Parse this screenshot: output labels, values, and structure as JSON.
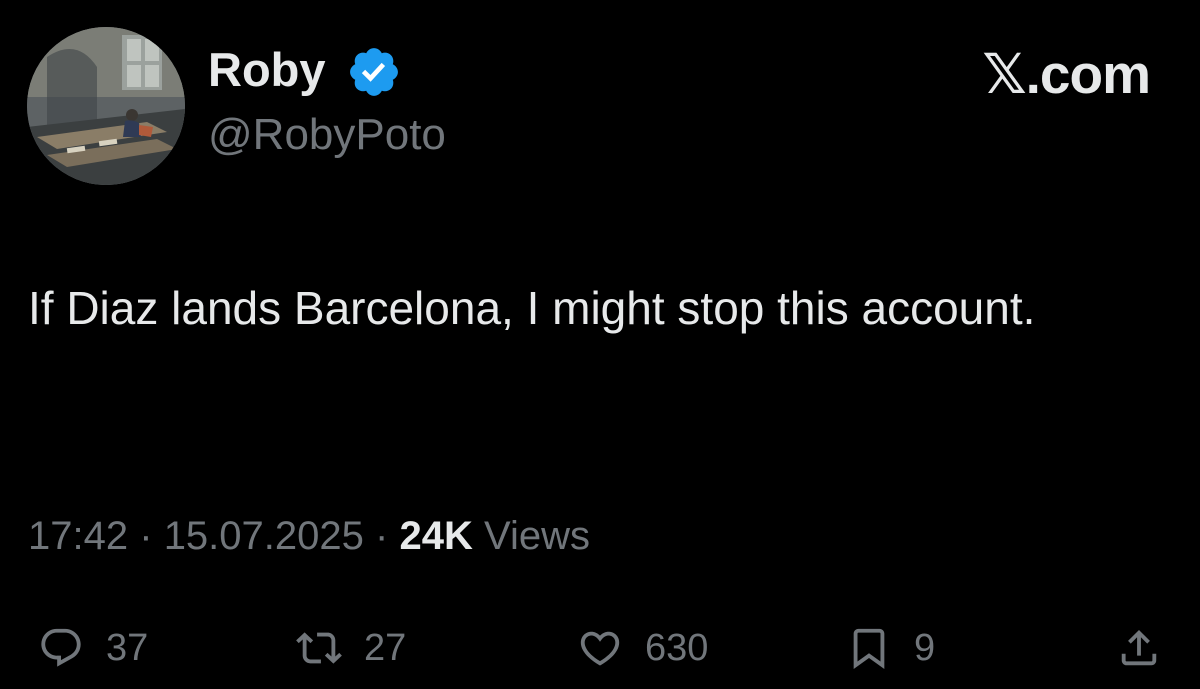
{
  "user": {
    "display_name": "Roby",
    "handle": "@RobyPoto",
    "verified": true
  },
  "brand": "𝕏.com",
  "tweet": {
    "text": "If Diaz lands Barcelona, I might stop this account.",
    "time": "17:42",
    "date": "15.07.2025",
    "separator": "·",
    "views_count": "24K",
    "views_label": "Views"
  },
  "actions": {
    "reply_count": "37",
    "repost_count": "27",
    "like_count": "630",
    "bookmark_count": "9"
  },
  "colors": {
    "background": "#000000",
    "primary_text": "#e7e9ea",
    "secondary_text": "#71767b",
    "verified_blue": "#1d9bf0"
  },
  "icons": {
    "verified": "verified-badge-icon",
    "reply": "reply-icon",
    "repost": "repost-icon",
    "like": "heart-icon",
    "bookmark": "bookmark-icon",
    "share": "share-icon"
  }
}
